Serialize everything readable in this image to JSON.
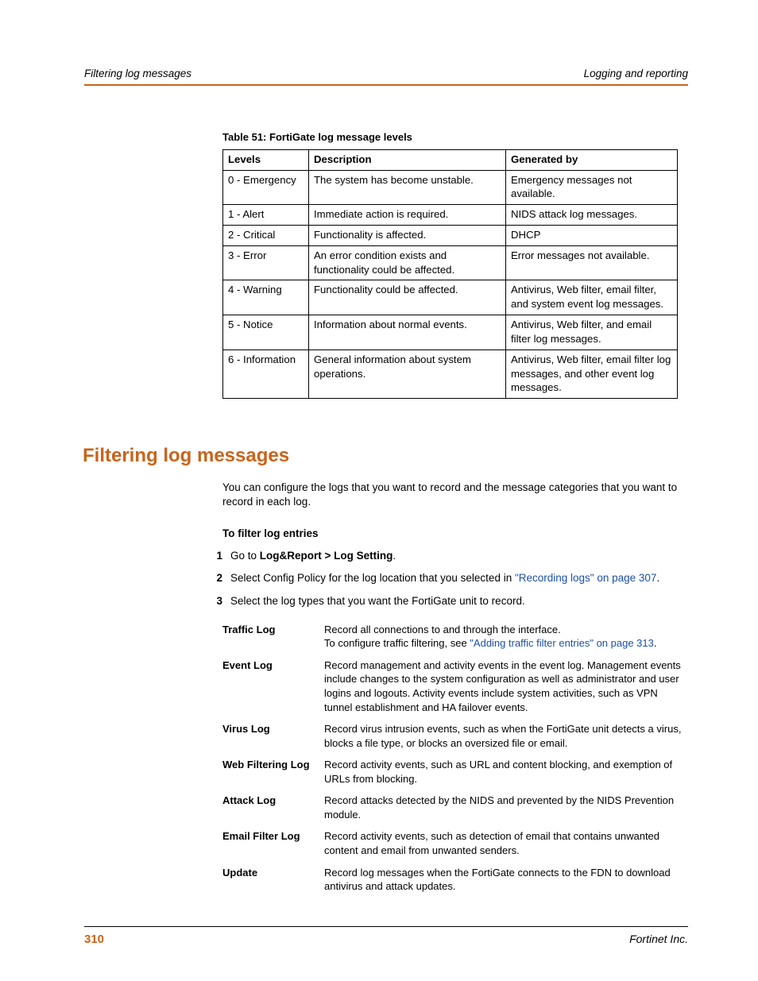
{
  "header": {
    "left": "Filtering log messages",
    "right": "Logging and reporting"
  },
  "table": {
    "caption": "Table 51: FortiGate log message levels",
    "headers": [
      "Levels",
      "Description",
      "Generated by"
    ],
    "rows": [
      [
        "0 - Emergency",
        "The system has become unstable.",
        "Emergency messages not available."
      ],
      [
        "1 - Alert",
        "Immediate action is required.",
        "NIDS attack log messages."
      ],
      [
        "2 - Critical",
        "Functionality is affected.",
        "DHCP"
      ],
      [
        "3 - Error",
        "An error condition exists and functionality could be affected.",
        "Error messages not available."
      ],
      [
        "4 - Warning",
        "Functionality could be affected.",
        "Antivirus, Web filter, email filter, and system event log messages."
      ],
      [
        "5 - Notice",
        "Information about normal events.",
        "Antivirus, Web filter, and email filter log messages."
      ],
      [
        "6 - Information",
        "General information about system operations.",
        "Antivirus, Web filter, email filter log messages, and other event log messages."
      ]
    ]
  },
  "section": {
    "title": "Filtering log messages",
    "intro": "You can configure the logs that you want to record and the message categories that you want to record in each log.",
    "proc_heading": "To filter log entries",
    "steps": {
      "s1_pre": "Go to ",
      "s1_bold": "Log&Report > Log Setting",
      "s1_post": ".",
      "s2_pre": "Select Config Policy for the log location that you selected in ",
      "s2_link": "\"Recording logs\" on page 307",
      "s2_post": ".",
      "s3": "Select the log types that you want the FortiGate unit to record."
    },
    "logtypes": [
      {
        "name": "Traffic Log",
        "desc_pre": "Record all connections to and through the interface.\nTo configure traffic filtering, see ",
        "desc_link": "\"Adding traffic filter entries\" on page 313",
        "desc_post": "."
      },
      {
        "name": "Event Log",
        "desc": "Record management and activity events in the event log. Management events include changes to the system configuration as well as administrator and user logins and logouts. Activity events include system activities, such as VPN tunnel establishment and HA failover events."
      },
      {
        "name": "Virus Log",
        "desc": "Record virus intrusion events, such as when the FortiGate unit detects a virus, blocks a file type, or blocks an oversized file or email."
      },
      {
        "name": "Web Filtering Log",
        "desc": "Record activity events, such as URL and content blocking, and exemption of URLs from blocking."
      },
      {
        "name": "Attack Log",
        "desc": "Record attacks detected by the NIDS and prevented by the NIDS Prevention module."
      },
      {
        "name": "Email Filter Log",
        "desc": "Record activity events, such as detection of email that contains unwanted content and email from unwanted senders."
      },
      {
        "name": "Update",
        "desc": "Record log messages when the FortiGate connects to the FDN to download antivirus and attack updates."
      }
    ]
  },
  "footer": {
    "page": "310",
    "company": "Fortinet Inc."
  }
}
